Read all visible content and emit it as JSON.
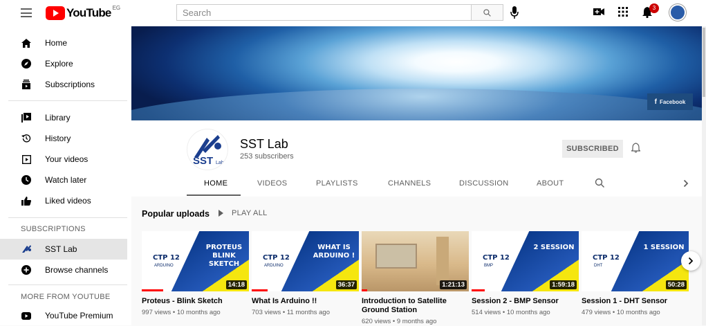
{
  "topbar": {
    "logo_text": "YouTube",
    "country_code": "EG",
    "search_placeholder": "Search",
    "notification_count": "3"
  },
  "sidebar": {
    "main": [
      {
        "label": "Home",
        "icon": "home-icon"
      },
      {
        "label": "Explore",
        "icon": "compass-icon"
      },
      {
        "label": "Subscriptions",
        "icon": "subscriptions-icon"
      }
    ],
    "library": [
      {
        "label": "Library",
        "icon": "library-icon"
      },
      {
        "label": "History",
        "icon": "history-icon"
      },
      {
        "label": "Your videos",
        "icon": "your-videos-icon"
      },
      {
        "label": "Watch later",
        "icon": "watch-later-icon"
      },
      {
        "label": "Liked videos",
        "icon": "thumbs-up-icon"
      }
    ],
    "subscriptions_header": "SUBSCRIPTIONS",
    "subscriptions": [
      {
        "label": "SST Lab",
        "icon": "channel-avatar-icon",
        "active": true
      },
      {
        "label": "Browse channels",
        "icon": "add-circle-icon"
      }
    ],
    "more_header": "MORE FROM YOUTUBE",
    "more": [
      {
        "label": "YouTube Premium",
        "icon": "youtube-premium-icon"
      }
    ]
  },
  "banner": {
    "facebook_label": "Facebook"
  },
  "channel": {
    "name": "SST Lab",
    "subscribers": "253 subscribers",
    "subscribe_label": "SUBSCRIBED",
    "avatar_text": "SST",
    "avatar_sub": "Lab"
  },
  "tabs": [
    "HOME",
    "VIDEOS",
    "PLAYLISTS",
    "CHANNELS",
    "DISCUSSION",
    "ABOUT"
  ],
  "section": {
    "title": "Popular uploads",
    "play_all": "PLAY ALL"
  },
  "videos": [
    {
      "title": "Proteus - Blink Sketch",
      "meta": "997 views • 10 months ago",
      "duration": "14:18",
      "thumb_headline": "PROTEUS BLINK SKETCH",
      "ctp": "CTP 12",
      "thumb_sub": "ARDUINO",
      "progress": 0.2
    },
    {
      "title": "What Is Arduino !!",
      "meta": "703 views • 11 months ago",
      "duration": "36:37",
      "thumb_headline": "WHAT IS ARDUINO !",
      "ctp": "CTP 12",
      "thumb_sub": "ARDUINO",
      "progress": 0.15
    },
    {
      "title": "Introduction to Satellite Ground Station",
      "meta": "620 views • 9 months ago",
      "duration": "1:21:13",
      "thumb_headline": "",
      "ctp": "",
      "thumb_sub": "",
      "progress": 0.05
    },
    {
      "title": "Session 2 - BMP Sensor",
      "meta": "514 views • 10 months ago",
      "duration": "1:59:18",
      "thumb_headline": "2 SESSION",
      "ctp": "CTP 12",
      "thumb_sub": "BMP",
      "progress": 0.12
    },
    {
      "title": "Session 1 - DHT Sensor",
      "meta": "479 views • 10 months ago",
      "duration": "50:28",
      "thumb_headline": "1 SESSION",
      "ctp": "CTP 12",
      "thumb_sub": "DHT",
      "progress": 0.0
    }
  ]
}
